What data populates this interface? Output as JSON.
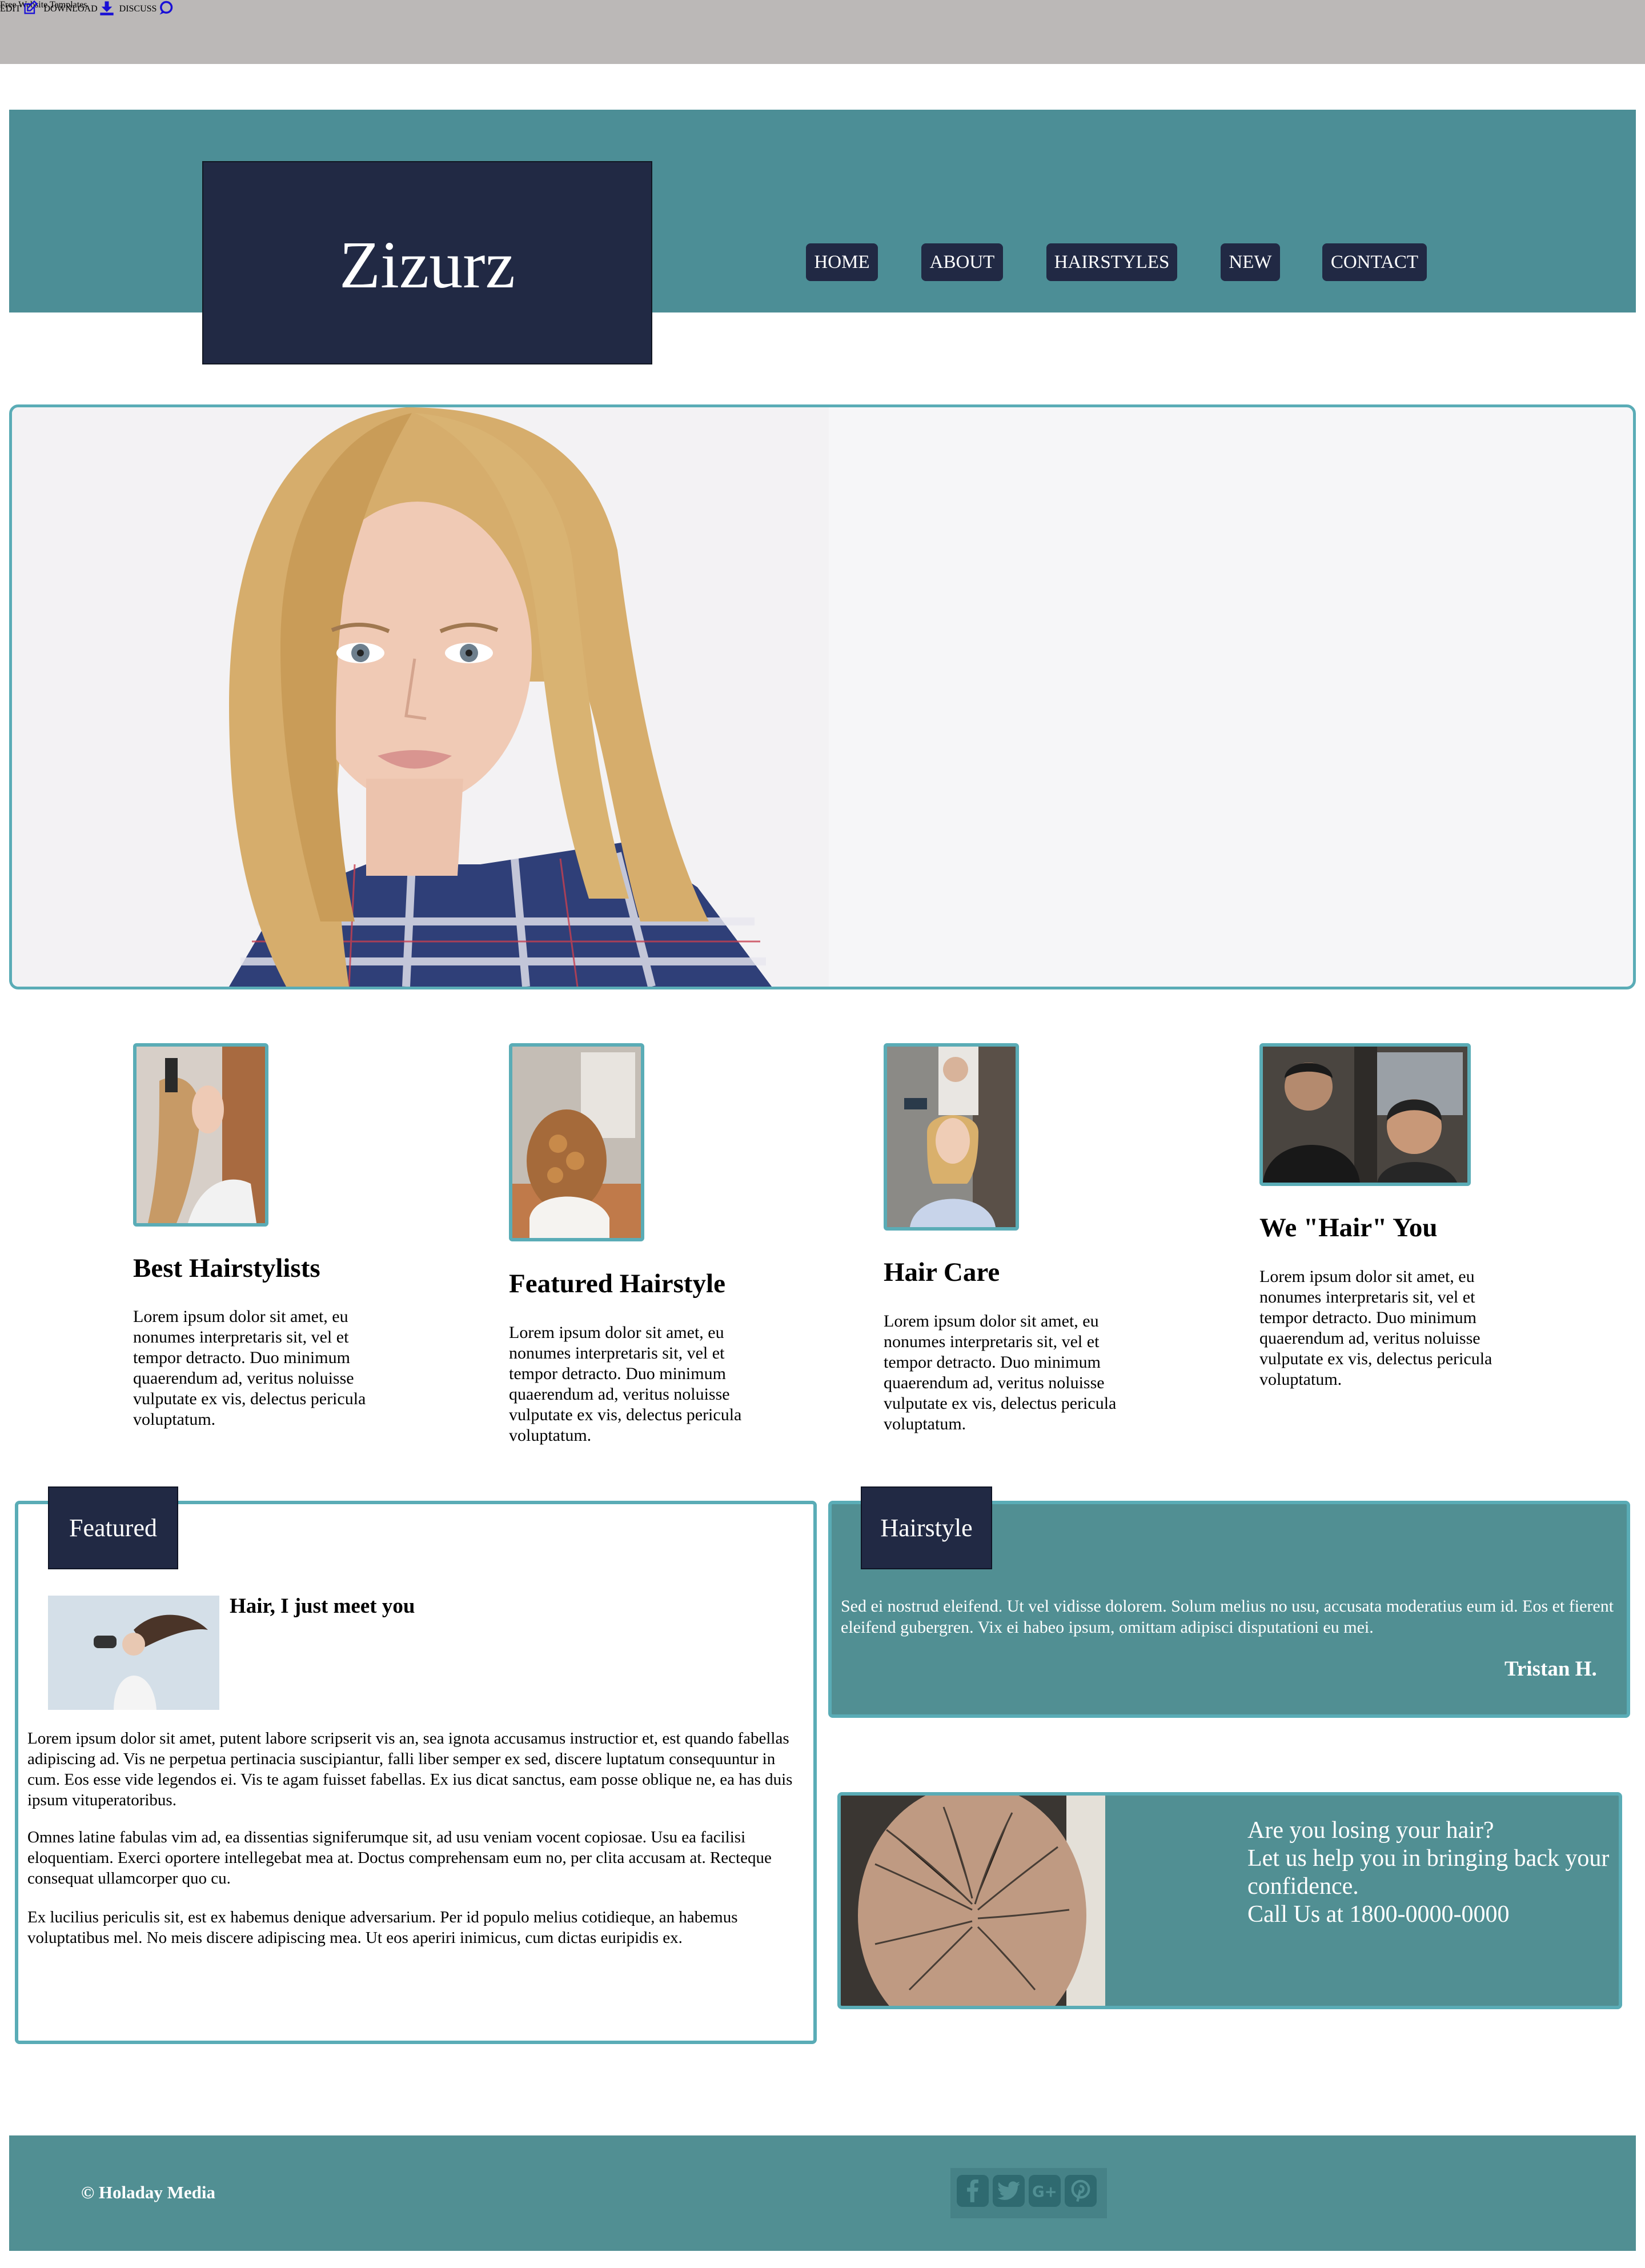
{
  "topbar": {
    "title": "Free Website Templates",
    "links": [
      {
        "label": "EDIT",
        "icon": "edit-icon"
      },
      {
        "label": "DOWNLOAD",
        "icon": "download-icon"
      },
      {
        "label": "DISCUSS",
        "icon": "chat-icon"
      }
    ]
  },
  "header": {
    "logo": "Zizurz",
    "nav": [
      "HOME",
      "ABOUT",
      "HAIRSTYLES",
      "NEW",
      "CONTACT"
    ]
  },
  "hero": {
    "image": "woman-portrait-photo"
  },
  "features": [
    {
      "heading": "Best Hairstylists",
      "text": "Lorem ipsum dolor sit amet, eu nonumes interpretaris sit, vel et tempor detracto. Duo minimum quaerendum ad, veritus noluisse vulputate ex vis, delectus pericula voluptatum."
    },
    {
      "heading": "Featured Hairstyle",
      "text": "Lorem ipsum dolor sit amet, eu nonumes interpretaris sit, vel et tempor detracto. Duo minimum quaerendum ad, veritus noluisse vulputate ex vis, delectus pericula voluptatum."
    },
    {
      "heading": "Hair Care",
      "text": "Lorem ipsum dolor sit amet, eu nonumes interpretaris sit, vel et tempor detracto. Duo minimum quaerendum ad, veritus noluisse vulputate ex vis, delectus pericula voluptatum."
    },
    {
      "heading": "We \"Hair\" You",
      "text": "Lorem ipsum dolor sit amet, eu nonumes interpretaris sit, vel et tempor detracto. Duo minimum quaerendum ad, veritus noluisse vulputate ex vis, delectus pericula voluptatum."
    }
  ],
  "featured": {
    "tab": "Featured",
    "title": "Hair, I just meet you",
    "paragraphs": [
      "Lorem ipsum dolor sit amet, putent labore scripserit vis an, sea ignota accusamus instructior et, est quando fabellas adipiscing ad. Vis ne perpetua pertinacia suscipiantur, falli liber semper ex sed, discere luptatum consequuntur in cum. Eos esse vide legendos ei. Vis te agam fuisset fabellas. Ex ius dicat sanctus, eam posse oblique ne, ea has duis ipsum vituperatoribus.",
      "Omnes latine fabulas vim ad, ea dissentias signiferumque sit, ad usu veniam vocent copiosae. Usu ea facilisi eloquentiam. Exerci oportere intellegebat mea at. Doctus comprehensam eum no, per clita accusam at. Recteque consequat ullamcorper quo cu.",
      "Ex lucilius periculis sit, est ex habemus denique adversarium. Per id populo melius cotidieque, an habemus voluptatibus mel. No meis discere adipiscing mea. Ut eos aperiri inimicus, cum dictas euripidis ex."
    ]
  },
  "hairstyle": {
    "tab": "Hairstyle",
    "quote": "Sed ei nostrud eleifend. Ut vel vidisse dolorem. Solum melius no usu, accusata moderatius eum id. Eos et fierent eleifend gubergren. Vix ei habeo ipsum, omittam adipisci disputationi eu mei.",
    "author": "Tristan H."
  },
  "promo": {
    "lines": [
      "Are you losing your hair?",
      "Let us help you in bringing back your confidence.",
      "Call Us at 1800-0000-0000"
    ]
  },
  "footer": {
    "copyright": "© Holaday Media",
    "social": [
      "facebook-icon",
      "twitter-icon",
      "google-plus-icon",
      "pinterest-icon"
    ]
  },
  "colors": {
    "teal": "#4c8e96",
    "teal_dark": "#518f93",
    "border": "#5aacb6",
    "navy": "#212944",
    "topbar": "#bbb8b7",
    "link": "#1a10d6"
  }
}
